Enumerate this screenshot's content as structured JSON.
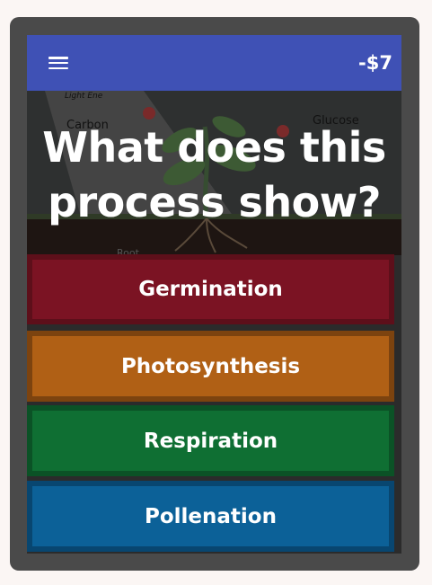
{
  "header": {
    "menu_icon": "hamburger-menu-icon",
    "score": "-$7"
  },
  "question": {
    "line1": "What does this",
    "line2": "process show?"
  },
  "image_labels": {
    "light": "Light Ene",
    "carbon": "Carbon",
    "glucose": "Glucose",
    "root": "Root"
  },
  "answers": [
    {
      "label": "Germination",
      "color": "#7b1323"
    },
    {
      "label": "Photosynthesis",
      "color": "#b06015"
    },
    {
      "label": "Respiration",
      "color": "#0f6f33"
    },
    {
      "label": "Pollenation",
      "color": "#0c6198"
    }
  ]
}
